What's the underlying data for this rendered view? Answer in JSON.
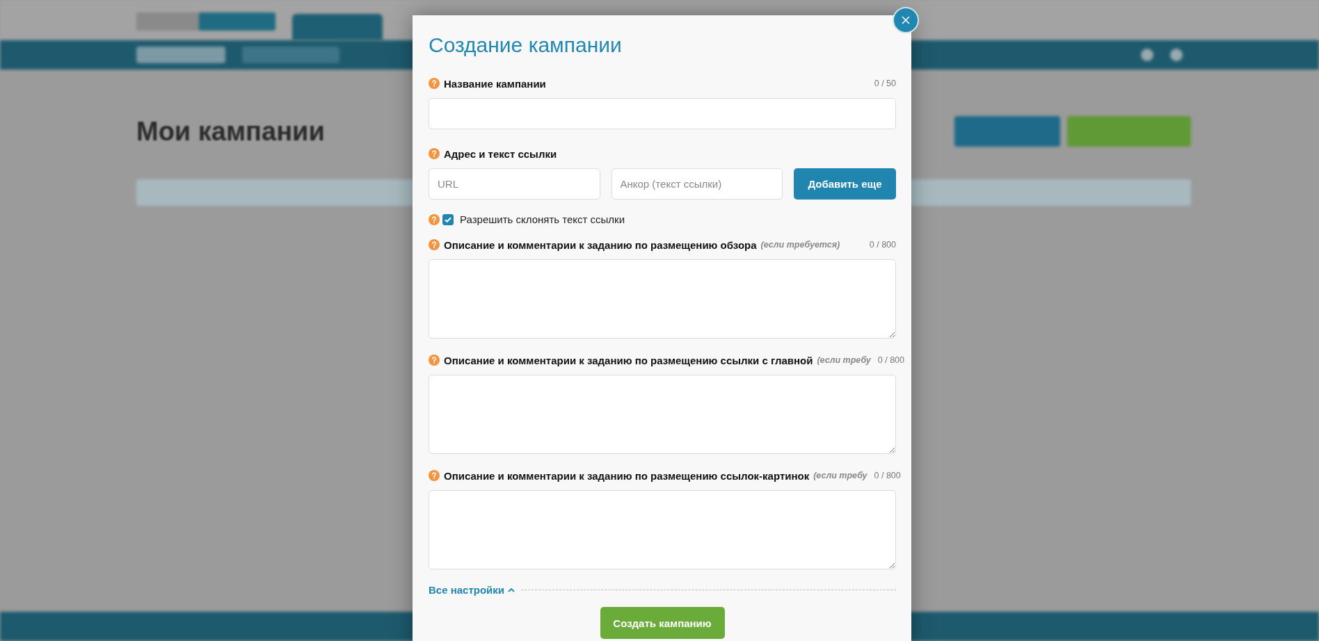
{
  "page": {
    "title": "Мои кампании"
  },
  "modal": {
    "title": "Создание кампании",
    "fields": [
      {
        "kind": "input",
        "label": "Название кампании",
        "counter": "0 / 50"
      },
      {
        "kind": "link_row",
        "label": "Адрес и текст ссылки",
        "url_placeholder": "URL",
        "anchor_placeholder": "Анкор (текст ссылки)",
        "button": "Добавить еще"
      },
      {
        "kind": "checkbox",
        "label": "Разрешить склонять текст ссылки",
        "checked": true
      },
      {
        "kind": "textarea",
        "label": "Описание и комментарии к заданию по размещению обзора",
        "note": "(если требуется)",
        "counter": "0 / 800"
      },
      {
        "kind": "textarea",
        "label": "Описание и комментарии к заданию по размещению ссылки с главной",
        "note": "(если требу",
        "counter": "0 / 800"
      },
      {
        "kind": "textarea",
        "label": "Описание и комментарии к заданию по размещению ссылок-картинок",
        "note": "(если требу",
        "counter": "0 / 800"
      }
    ],
    "settings_link": "Все настройки",
    "submit": "Создать кампанию"
  }
}
